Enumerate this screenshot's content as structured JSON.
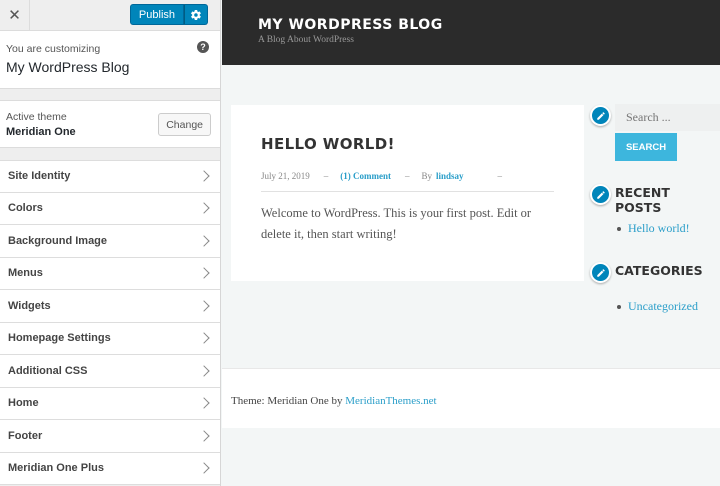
{
  "customizer": {
    "publish_label": "Publish",
    "info_sub": "You are customizing",
    "info_title": "My WordPress Blog",
    "active_theme_label": "Active theme",
    "theme_name": "Meridian One",
    "change_label": "Change",
    "menu_items": [
      "Site Identity",
      "Colors",
      "Background Image",
      "Menus",
      "Widgets",
      "Homepage Settings",
      "Additional CSS",
      "Home",
      "Footer",
      "Meridian One Plus"
    ]
  },
  "site": {
    "title": "MY WORDPRESS BLOG",
    "tagline": "A Blog About WordPress",
    "post": {
      "title": "HELLO WORLD!",
      "date": "July 21, 2019",
      "comments": "(1) Comment",
      "by": "By",
      "author": "lindsay",
      "sep": "–",
      "body": "Welcome to WordPress. This is your first post. Edit or delete it, then start writing!"
    },
    "search": {
      "placeholder": "Search ...",
      "button": "SEARCH"
    },
    "recent_posts": {
      "title": "RECENT POSTS",
      "items": [
        "Hello world!"
      ]
    },
    "categories": {
      "title": "CATEGORIES",
      "items": [
        "Uncategorized"
      ]
    },
    "footer": {
      "text": "Theme: Meridian One by ",
      "link": "MeridianThemes.net"
    }
  },
  "colors": {
    "primary": "#0085ba",
    "accent": "#3db6dd",
    "link": "#2a9ec9",
    "header_bg": "#2b2b2b"
  },
  "icons": {
    "close": "close-icon",
    "settings": "gear-icon",
    "help": "help-icon",
    "chevron": "chevron-right-icon",
    "edit": "pencil-icon"
  }
}
